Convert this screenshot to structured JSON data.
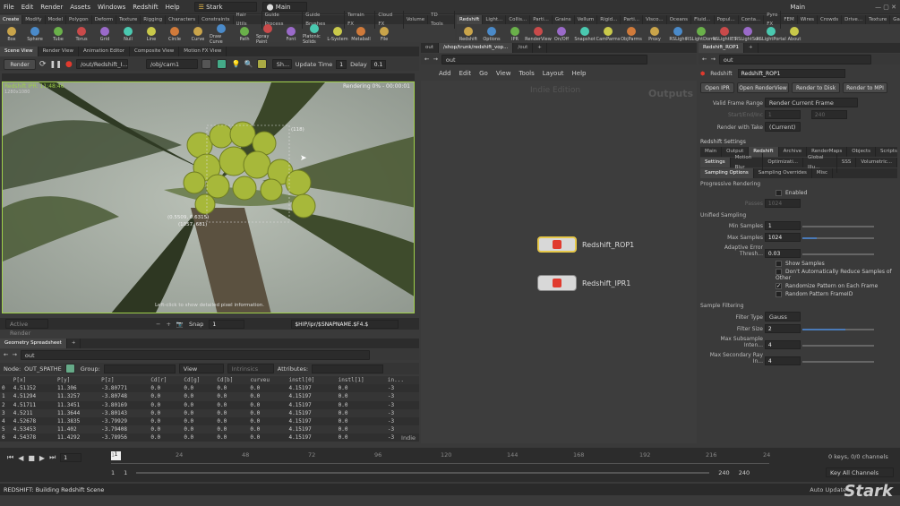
{
  "menu": [
    "File",
    "Edit",
    "Render",
    "Assets",
    "Windows",
    "Redshift",
    "Help"
  ],
  "desktop": "Stark",
  "desktop_main": "Main",
  "right_title": "Main",
  "shelf_left_tabs": [
    "Create",
    "Modify",
    "Model",
    "Polygon",
    "Deform",
    "Texture",
    "Rigging",
    "Characters",
    "Constraints",
    "Hair Utils",
    "Guide Process",
    "Guide Brushes",
    "Terrain FX",
    "Cloud FX",
    "Volume",
    "TD Tools"
  ],
  "shelf_left_tools": [
    "Box",
    "Sphere",
    "Tube",
    "Torus",
    "Grid",
    "Null",
    "Line",
    "Circle",
    "Curve",
    "Draw Curve",
    "Path",
    "Spray Paint",
    "Font",
    "Platonic Solids",
    "L-System",
    "Metaball",
    "File"
  ],
  "shelf_right_tabs": [
    "Redshift",
    "Light...",
    "Collis...",
    "Parti...",
    "Grains",
    "Vellum",
    "Rigid...",
    "Parti...",
    "Visco...",
    "Oceans",
    "Fluid...",
    "Popul...",
    "Conta...",
    "Pyro FX",
    "FEM",
    "Wires",
    "Crowds",
    "Drive...",
    "Texture",
    "Game..."
  ],
  "shelf_right_tools": [
    "Redshift",
    "Options",
    "IPR",
    "RenderView",
    "On/Off",
    "Snapshot",
    "CamParms",
    "ObjParms",
    "Proxy",
    "RSLight",
    "RSLightDome",
    "RSLightIES",
    "RSLightSun",
    "RSLightPortal",
    "About"
  ],
  "left_pane_tabs": [
    "Scene View",
    "Render View",
    "Animation Editor",
    "Composite View",
    "Motion FX View"
  ],
  "render_btn": "Render",
  "render_path": "/out/Redshift_I...",
  "cam_path": "/obj/cam1",
  "sh_label": "Sh...",
  "update_time_label": "Update Time",
  "update_time_val": "1",
  "delay_label": "Delay",
  "delay_val": "0.1",
  "viewport_top_left": "Redshift IPR: 11:48:46",
  "viewport_top_left2": "1280x1080",
  "viewport_status": "Rendering 0% - 00:00:01",
  "viewport_coord1": "(0.5509, 0.6315)",
  "viewport_coord2": "(1057, 681)",
  "viewport_box_label": "(118)",
  "viewport_hint": "Left-click to show detailed pixel information.",
  "active_render": "Active Render",
  "snap_label": "Snap",
  "snap_val": "1",
  "snap_path": "$HIP/ipr/$SNAPNAME.$F4.$",
  "sheet_tab": "Geometry Spreadsheet",
  "sheet_path": "out",
  "sheet_node_label": "Node:",
  "sheet_node": "OUT_SPATHE",
  "sheet_group_label": "Group:",
  "sheet_view": "View",
  "sheet_intrinsics": "Intrinsics",
  "sheet_attributes": "Attributes:",
  "sheet_cols": [
    "",
    "P[x]",
    "P[y]",
    "P[z]",
    "Cd[r]",
    "Cd[g]",
    "Cd[b]",
    "curveu",
    "instl[0]",
    "instl[1]",
    "in..."
  ],
  "sheet_rows": [
    [
      "0",
      "4.51152",
      "11.306",
      "-3.80771",
      "0.0",
      "0.0",
      "0.0",
      "0.0",
      "4.15197",
      "0.0",
      "-3"
    ],
    [
      "1",
      "4.51294",
      "11.3257",
      "-3.80748",
      "0.0",
      "0.0",
      "0.0",
      "0.0",
      "4.15197",
      "0.0",
      "-3"
    ],
    [
      "2",
      "4.51711",
      "11.3451",
      "-3.80169",
      "0.0",
      "0.0",
      "0.0",
      "0.0",
      "4.15197",
      "0.0",
      "-3"
    ],
    [
      "3",
      "4.5211",
      "11.3644",
      "-3.80143",
      "0.0",
      "0.0",
      "0.0",
      "0.0",
      "4.15197",
      "0.0",
      "-3"
    ],
    [
      "4",
      "4.52678",
      "11.3835",
      "-3.79929",
      "0.0",
      "0.0",
      "0.0",
      "0.0",
      "4.15197",
      "0.0",
      "-3"
    ],
    [
      "5",
      "4.53453",
      "11.402",
      "-3.79408",
      "0.0",
      "0.0",
      "0.0",
      "0.0",
      "4.15197",
      "0.0",
      "-3"
    ],
    [
      "6",
      "4.54378",
      "11.4292",
      "-3.78956",
      "0.0",
      "0.0",
      "0.0",
      "0.0",
      "4.15197",
      "0.0",
      "-3"
    ]
  ],
  "sheet_indie": "Indie ",
  "net_tabs": [
    "out",
    "/shop/trunk/redshift_vop...",
    "/out"
  ],
  "net_path": "out",
  "net_menu": [
    "Add",
    "Edit",
    "Go",
    "View",
    "Tools",
    "Layout",
    "Help"
  ],
  "net_watermark": "Indie Edition",
  "net_context": "Outputs",
  "node1": "Redshift_ROP1",
  "node2": "Redshift_IPR1",
  "params_tab": "Redshift_ROP1",
  "params_path": "out",
  "params_type": "Redshift",
  "params_name": "Redshift_ROP1",
  "params_buttons": [
    "Open IPR",
    "Open RenderView",
    "Render to Disk",
    "Render to MPI"
  ],
  "valid_frame_label": "Valid Frame Range",
  "valid_frame_val": "Render Current Frame",
  "start_end_label": "Start/End/Inc",
  "start_val": "1",
  "end_val": "240",
  "take_label": "Render with Take",
  "take_val": "(Current)",
  "settings_label": "Redshift Settings",
  "tabs1": [
    "Main",
    "Output",
    "Redshift",
    "Archive",
    "RenderMaps",
    "Objects",
    "Scripts",
    "IPR"
  ],
  "tabs2": [
    "Settings",
    "Motion Blur",
    "Optimizati...",
    "Global Illu...",
    "SSS",
    "Volumetric..."
  ],
  "tabs3": [
    "Sampling Options",
    "Sampling Overrides",
    "Misc"
  ],
  "prog_title": "Progressive Rendering",
  "enabled": "Enabled",
  "passes_label": "Passes",
  "passes_val": "1024",
  "unified_title": "Unified Sampling",
  "min_label": "Min Samples",
  "min_val": "1",
  "max_label": "Max Samples",
  "max_val": "1024",
  "aet_label": "Adaptive Error Thresh...",
  "aet_val": "0.03",
  "show_samples": "Show Samples",
  "dont_reduce": "Don't Automatically Reduce Samples of Other",
  "randomize": "Randomize Pattern on Each Frame",
  "random_id": "Random Pattern FrameID",
  "filter_title": "Sample Filtering",
  "filter_type_label": "Filter Type",
  "filter_type_val": "Gauss",
  "filter_size_label": "Filter Size",
  "filter_size_val": "2",
  "max_sub_label": "Max Subsample Inten...",
  "max_sub_val": "4",
  "max_sec_label": "Max Secondary Ray In...",
  "max_sec_val": "4",
  "timeline_frame": "1",
  "timeline_ticks": [
    "1",
    "24",
    "48",
    "72",
    "96",
    "120",
    "144",
    "168",
    "192",
    "216",
    "24"
  ],
  "range_start": "1",
  "range_start2": "1",
  "range_end": "240",
  "range_end2": "240",
  "keys_info": "0 keys, 0/0 channels",
  "key_all": "Key All Channels",
  "status_text": "REDSHIFT: Building Redshift Scene",
  "auto_update": "Auto Update",
  "logo": "Stark"
}
